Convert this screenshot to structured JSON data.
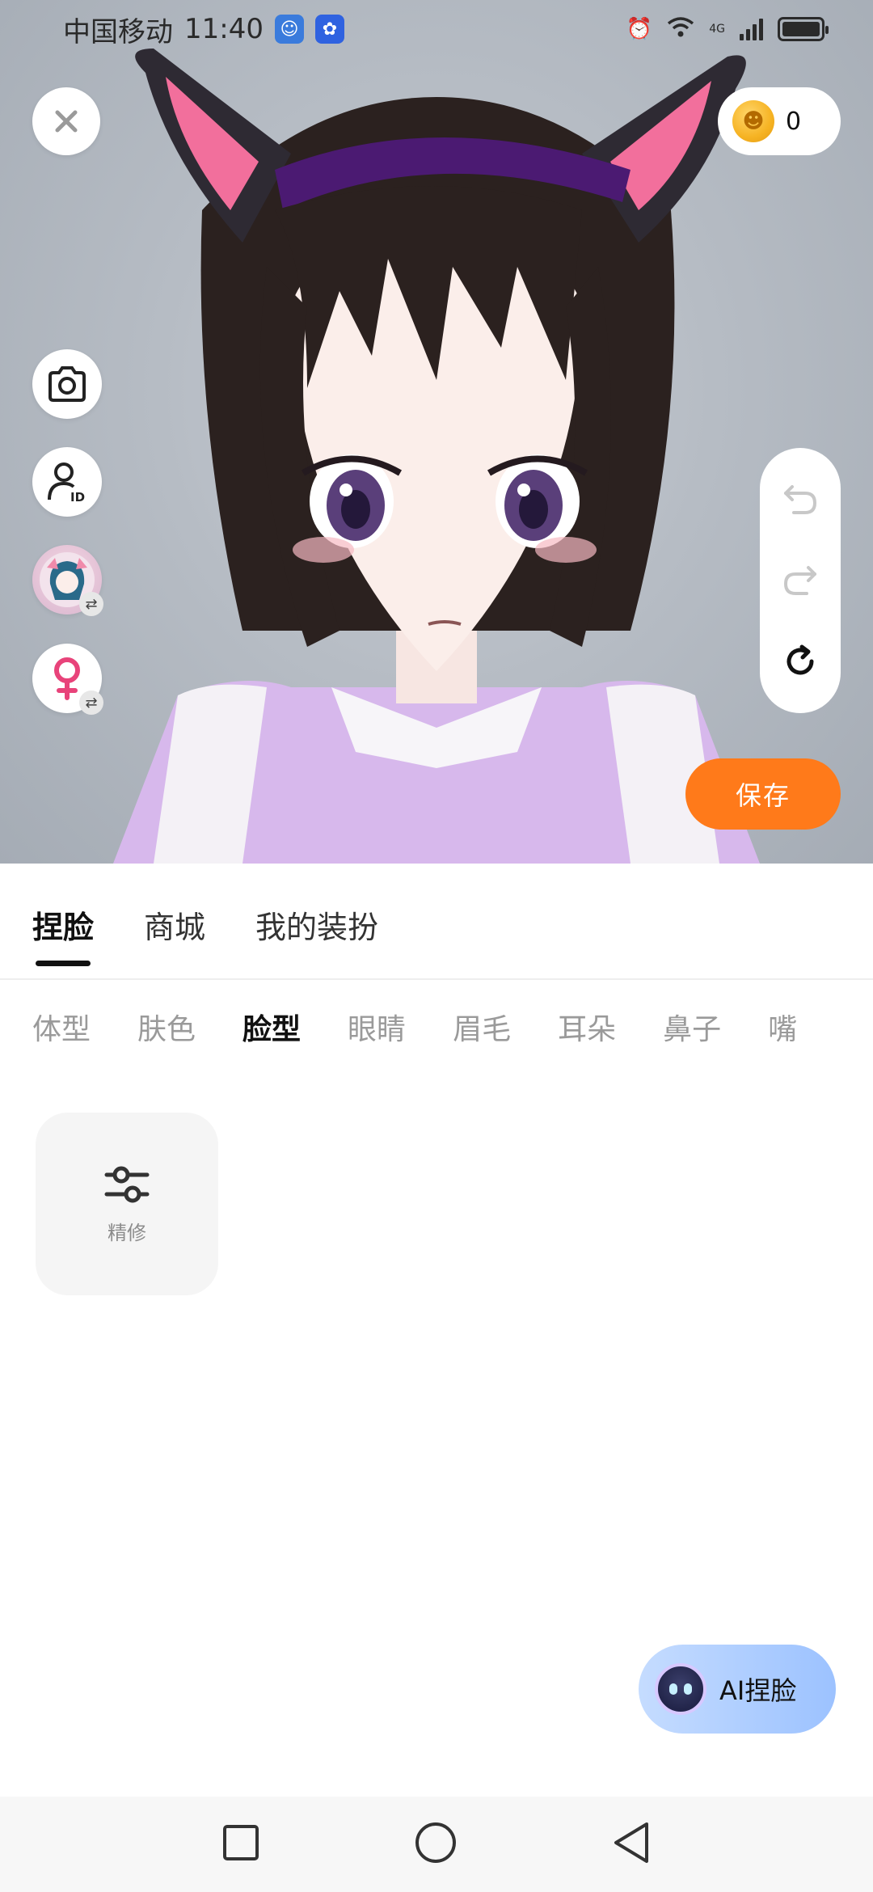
{
  "status_bar": {
    "carrier": "中国移动",
    "time": "11:40",
    "network": "4G"
  },
  "top_controls": {
    "coin_count": "0",
    "save_label": "保存"
  },
  "main_tabs": [
    {
      "label": "捏脸",
      "active": true
    },
    {
      "label": "商城",
      "active": false
    },
    {
      "label": "我的装扮",
      "active": false
    }
  ],
  "sub_tabs": [
    {
      "label": "体型",
      "active": false
    },
    {
      "label": "肤色",
      "active": false
    },
    {
      "label": "脸型",
      "active": true
    },
    {
      "label": "眼睛",
      "active": false
    },
    {
      "label": "眉毛",
      "active": false
    },
    {
      "label": "耳朵",
      "active": false
    },
    {
      "label": "鼻子",
      "active": false
    },
    {
      "label": "嘴",
      "active": false
    }
  ],
  "tool_card": {
    "label": "精修",
    "icon": "sliders-icon"
  },
  "ai_button": {
    "label": "AI捏脸"
  },
  "colors": {
    "accent_orange": "#ff7a1a",
    "ai_button_blue": "#9cc2ff",
    "female_pink": "#e8437a"
  }
}
